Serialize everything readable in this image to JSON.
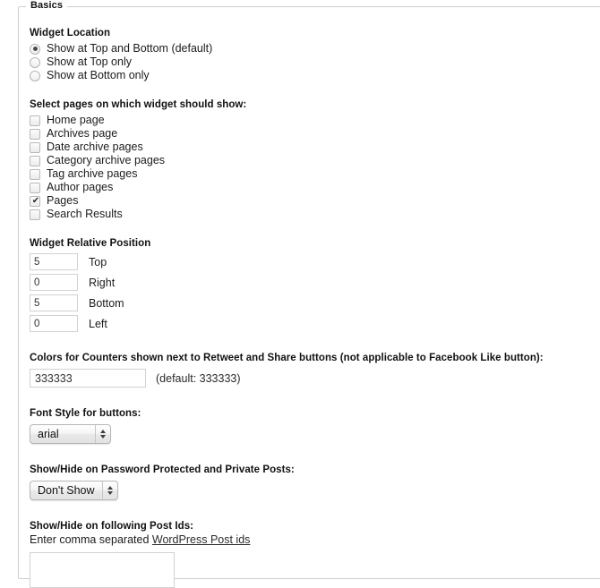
{
  "fieldset": {
    "legend": "Basics"
  },
  "widget_location": {
    "label": "Widget Location",
    "options": [
      {
        "label": "Show at Top and Bottom (default)",
        "selected": true
      },
      {
        "label": "Show at Top only",
        "selected": false
      },
      {
        "label": "Show at Bottom only",
        "selected": false
      }
    ]
  },
  "select_pages": {
    "label": "Select pages on which widget should show:",
    "options": [
      {
        "label": "Home page",
        "checked": false
      },
      {
        "label": "Archives page",
        "checked": false
      },
      {
        "label": "Date archive pages",
        "checked": false
      },
      {
        "label": "Category archive pages",
        "checked": false
      },
      {
        "label": "Tag archive pages",
        "checked": false
      },
      {
        "label": "Author pages",
        "checked": false
      },
      {
        "label": "Pages",
        "checked": true
      },
      {
        "label": "Search Results",
        "checked": false
      }
    ]
  },
  "relative_position": {
    "label": "Widget Relative Position",
    "fields": [
      {
        "value": "5",
        "name": "Top"
      },
      {
        "value": "0",
        "name": "Right"
      },
      {
        "value": "5",
        "name": "Bottom"
      },
      {
        "value": "0",
        "name": "Left"
      }
    ]
  },
  "counter_colors": {
    "label": "Colors for Counters shown next to Retweet and Share buttons (not applicable to Facebook Like button):",
    "value": "333333",
    "default_note": "(default: 333333)"
  },
  "font_style": {
    "label": "Font Style for buttons:",
    "value": "arial"
  },
  "password_protected": {
    "label": "Show/Hide on Password Protected and Private Posts:",
    "value": "Don't Show"
  },
  "post_ids": {
    "label": "Show/Hide on following Post Ids:",
    "hint_prefix": "Enter comma separated ",
    "hint_link": "WordPress Post ids",
    "value": ""
  }
}
